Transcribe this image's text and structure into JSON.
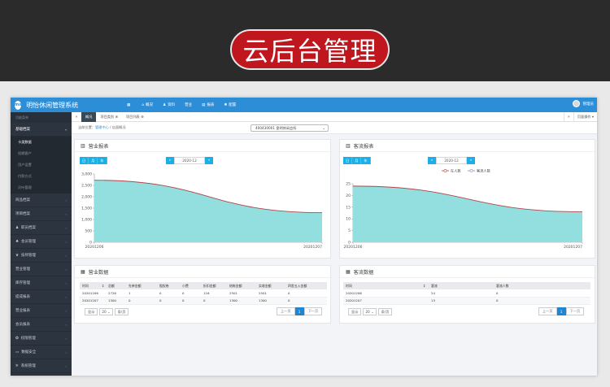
{
  "banner": {
    "title": "云后台管理",
    "accent": "#c0161e"
  },
  "app": {
    "logo_text": "ms",
    "title": "明怡休闲管理系统",
    "topnav": [
      {
        "icon": "grid-icon",
        "glyph": "▦",
        "label": ""
      },
      {
        "icon": "home-icon",
        "glyph": "⌂",
        "label": "概况"
      },
      {
        "icon": "user-icon",
        "glyph": "♟",
        "label": "资料"
      },
      {
        "icon": "",
        "glyph": "",
        "label": "营业"
      },
      {
        "icon": "chart-icon",
        "glyph": "▤",
        "label": "报表"
      },
      {
        "icon": "settings-icon",
        "glyph": "✱",
        "label": "配置"
      }
    ],
    "user_name": "管理员"
  },
  "sidebar": {
    "header": "功能菜单",
    "open_section": "基础档案",
    "sub_items": [
      "卡类数据",
      "短期客户",
      "用户设置",
      "付款方式",
      "贝叶管理"
    ],
    "active_sub": "卡类数据",
    "items": [
      {
        "label": "商品档案",
        "icon": ""
      },
      {
        "label": "项目档案",
        "icon": ""
      },
      {
        "label": "职员档案",
        "icon": "person-icon"
      },
      {
        "label": "会员管理",
        "icon": "members-icon"
      },
      {
        "label": "技师管理",
        "icon": "technician-icon"
      },
      {
        "label": "营业管理",
        "icon": ""
      },
      {
        "label": "库存管理",
        "icon": ""
      },
      {
        "label": "提成报表",
        "icon": ""
      },
      {
        "label": "营业报表",
        "icon": ""
      },
      {
        "label": "会员报表",
        "icon": ""
      },
      {
        "label": "权限管理",
        "icon": "shield-icon"
      },
      {
        "label": "数据安全",
        "icon": "monitor-icon"
      },
      {
        "label": "系统管理",
        "icon": "gear-icon"
      }
    ]
  },
  "tabs": {
    "items": [
      "概况",
      "项目类别 ⊗",
      "项目列表 ⊗"
    ],
    "active": "概况",
    "ops": "页面操作 ▾"
  },
  "crumb": {
    "prefix": "当前位置：",
    "link": "管理中心",
    "sep": " / ",
    "current": "店面概况"
  },
  "store_select": {
    "value": "400430001 皇明休闲会所"
  },
  "revenue_chart_panel": {
    "title": "营业报表",
    "buttons": [
      "日",
      "月",
      "年"
    ],
    "date": "2020-12",
    "prev": "«",
    "next": "»"
  },
  "traffic_chart_panel": {
    "title": "客流报表",
    "buttons": [
      "日",
      "月",
      "年"
    ],
    "date": "2020-12",
    "prev": "«",
    "next": "»"
  },
  "chart_data": [
    {
      "type": "area",
      "title": "营业报表",
      "x": [
        "20201206",
        "20201207"
      ],
      "series": [
        {
          "values": [
            2726,
            1300
          ]
        }
      ],
      "ylim": [
        0,
        3000
      ],
      "yticks": [
        "0",
        "500",
        "1,000",
        "1,500",
        "2,000",
        "2,500",
        "3,000"
      ],
      "fill": "#93dfe0",
      "line": "#b0464a"
    },
    {
      "type": "area",
      "title": "客流报表",
      "x": [
        "20201206",
        "20201207"
      ],
      "series": [
        {
          "name": "在人数",
          "values": [
            24,
            13
          ]
        },
        {
          "name": "客流人数",
          "values": [
            0,
            0
          ]
        }
      ],
      "ylim": [
        0,
        25
      ],
      "yticks": [
        "0",
        "5",
        "10",
        "15",
        "20",
        "25"
      ],
      "fill": "#93dfe0",
      "line": "#b0464a",
      "legend": "top-center"
    }
  ],
  "revenue_table": {
    "title": "营业数据",
    "columns": [
      "时间",
      "↕",
      "总额",
      "先单金额",
      "股权卷",
      "小费",
      "折扣金额",
      "结帐金额",
      "实收金额",
      "四舍五入金额"
    ],
    "rows": [
      [
        "20201206",
        "",
        "2726",
        "1",
        "0",
        "0",
        "116",
        "2501",
        "2501",
        "0"
      ],
      [
        "20201207",
        "",
        "1300",
        "0",
        "0",
        "0",
        "0",
        "1300",
        "1300",
        "0"
      ]
    ]
  },
  "traffic_table": {
    "title": "客流数据",
    "columns": [
      "时间",
      "↕",
      "客流",
      "客流人数"
    ],
    "rows": [
      [
        "20201206",
        "",
        "24",
        "0"
      ],
      [
        "20201207",
        "",
        "13",
        "0"
      ]
    ]
  },
  "pager": {
    "show": "显示",
    "page_size": "20",
    "per_page": "条/页",
    "prev": "上一页",
    "current": "1",
    "next": "下一页"
  }
}
